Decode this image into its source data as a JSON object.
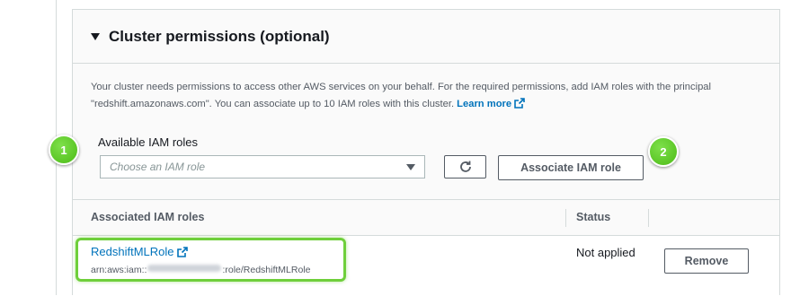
{
  "section": {
    "title": "Cluster permissions (optional)",
    "description": "Your cluster needs permissions to access other AWS services on your behalf. For the required permissions, add IAM roles with the principal \"redshift.amazonaws.com\". You can associate up to 10 IAM roles with this cluster.",
    "learn_more": "Learn more"
  },
  "available_roles": {
    "label": "Available IAM roles",
    "placeholder": "Choose an IAM role",
    "associate_button": "Associate IAM role"
  },
  "table": {
    "headers": [
      "Associated IAM roles",
      "Status"
    ],
    "rows": [
      {
        "name": "RedshiftMLRole",
        "arn_prefix": "arn:aws:iam::",
        "arn_suffix": ":role/RedshiftMLRole",
        "status": "Not applied",
        "action": "Remove"
      }
    ]
  },
  "badges": [
    "1",
    "2"
  ],
  "colors": {
    "link": "#0073bb",
    "highlight": "#6fcf3b",
    "badge": "#4cbb17"
  },
  "icons": [
    "caret-down-icon",
    "external-link-icon",
    "dropdown-arrow-icon",
    "refresh-icon"
  ]
}
